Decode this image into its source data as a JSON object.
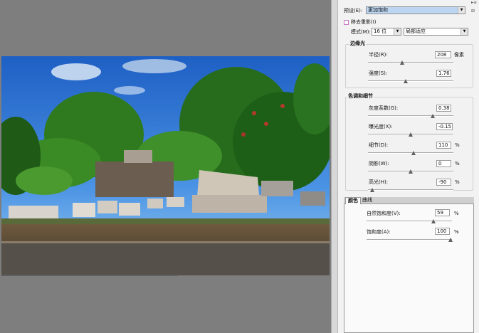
{
  "preset": {
    "label": "预设(E):",
    "value": "更加饱和"
  },
  "remove_ghost": {
    "label": "移去重影(I)"
  },
  "mode": {
    "label": "模式(M):",
    "bit_depth": "16 位",
    "method": "局部适应"
  },
  "edge_glow": {
    "title": "边缘光",
    "radius": {
      "label": "半径(R):",
      "value": "208",
      "unit": "像素",
      "level": 0.5
    },
    "strength": {
      "label": "强度(S):",
      "value": "1.76",
      "level": 0.45
    }
  },
  "tone_detail": {
    "title": "色调和细节",
    "gamma": {
      "label": "灰度系数(G):",
      "value": "0.38",
      "level": 0.9
    },
    "exposure": {
      "label": "曝光度(X):",
      "value": "-0.15",
      "level": 0.5
    },
    "detail": {
      "label": "细节(D):",
      "value": "110",
      "unit": "%",
      "level": 0.55
    },
    "shadow": {
      "label": "阴影(W):",
      "value": "0",
      "unit": "%",
      "level": 0.5
    },
    "highlight": {
      "label": "高光(H):",
      "value": "-90",
      "unit": "%",
      "level": 0.05
    }
  },
  "tabs": [
    {
      "label": "颜色"
    },
    {
      "label": "曲线"
    }
  ],
  "color": {
    "vibrance": {
      "label": "自然饱和度(V):",
      "value": "59",
      "unit": "%",
      "level": 0.8
    },
    "saturation": {
      "label": "饱和度(A):",
      "value": "100",
      "unit": "%",
      "level": 1.0
    }
  },
  "icons": {
    "panel_menu": "panel-menu-icon",
    "dropdown": "chevron-down-icon",
    "slider": "slider-thumb-icon"
  },
  "colors": {
    "canvas_bg": "#7e7e7e",
    "panel_bg": "#f2f2f2",
    "preset_highlight": "#bcd6f2",
    "checkbox_border": "#c678c6"
  }
}
